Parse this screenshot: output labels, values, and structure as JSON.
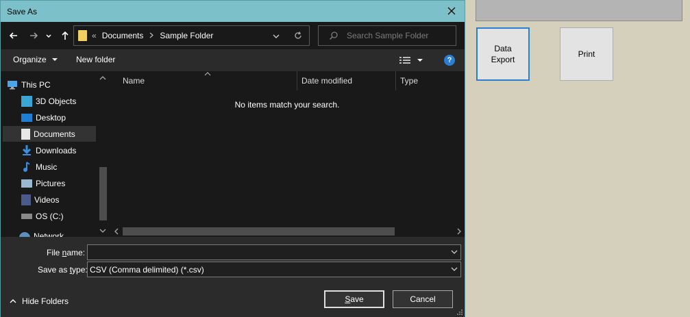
{
  "background_app": {
    "buttons": [
      {
        "label": "Data\nExport"
      },
      {
        "label": "Print"
      }
    ]
  },
  "dialog": {
    "title": "Save As",
    "address": {
      "overflow": "«",
      "crumbs": [
        "Documents",
        "Sample Folder"
      ]
    },
    "search_placeholder": "Search Sample Folder",
    "toolbar": {
      "organize": "Organize",
      "new_folder": "New folder",
      "help": "?"
    },
    "nav_items": [
      {
        "label": "This PC",
        "icon": "computer-icon"
      },
      {
        "label": "3D Objects",
        "icon": "cube-icon"
      },
      {
        "label": "Desktop",
        "icon": "desktop-icon"
      },
      {
        "label": "Documents",
        "icon": "document-icon",
        "selected": true
      },
      {
        "label": "Downloads",
        "icon": "download-icon"
      },
      {
        "label": "Music",
        "icon": "music-icon"
      },
      {
        "label": "Pictures",
        "icon": "pictures-icon"
      },
      {
        "label": "Videos",
        "icon": "videos-icon"
      },
      {
        "label": "OS (C:)",
        "icon": "drive-icon"
      },
      {
        "label": "Network",
        "icon": "network-icon"
      }
    ],
    "columns": [
      "Name",
      "Date modified",
      "Type"
    ],
    "empty_message": "No items match your search.",
    "file_name_label_pre": "File ",
    "file_name_label_ul": "n",
    "file_name_label_post": "ame:",
    "file_name_value": "",
    "save_type_label_pre": "Save as ",
    "save_type_label_ul": "t",
    "save_type_label_post": "ype:",
    "save_type_value": "CSV (Comma delimited) (*.csv)",
    "hide_folders": "Hide Folders",
    "save_ul": "S",
    "save_post": "ave",
    "cancel": "Cancel"
  },
  "colors": {
    "titlebar": "#7cc1c9",
    "dialog_bg": "#191919",
    "accent": "#2b7fd0"
  }
}
